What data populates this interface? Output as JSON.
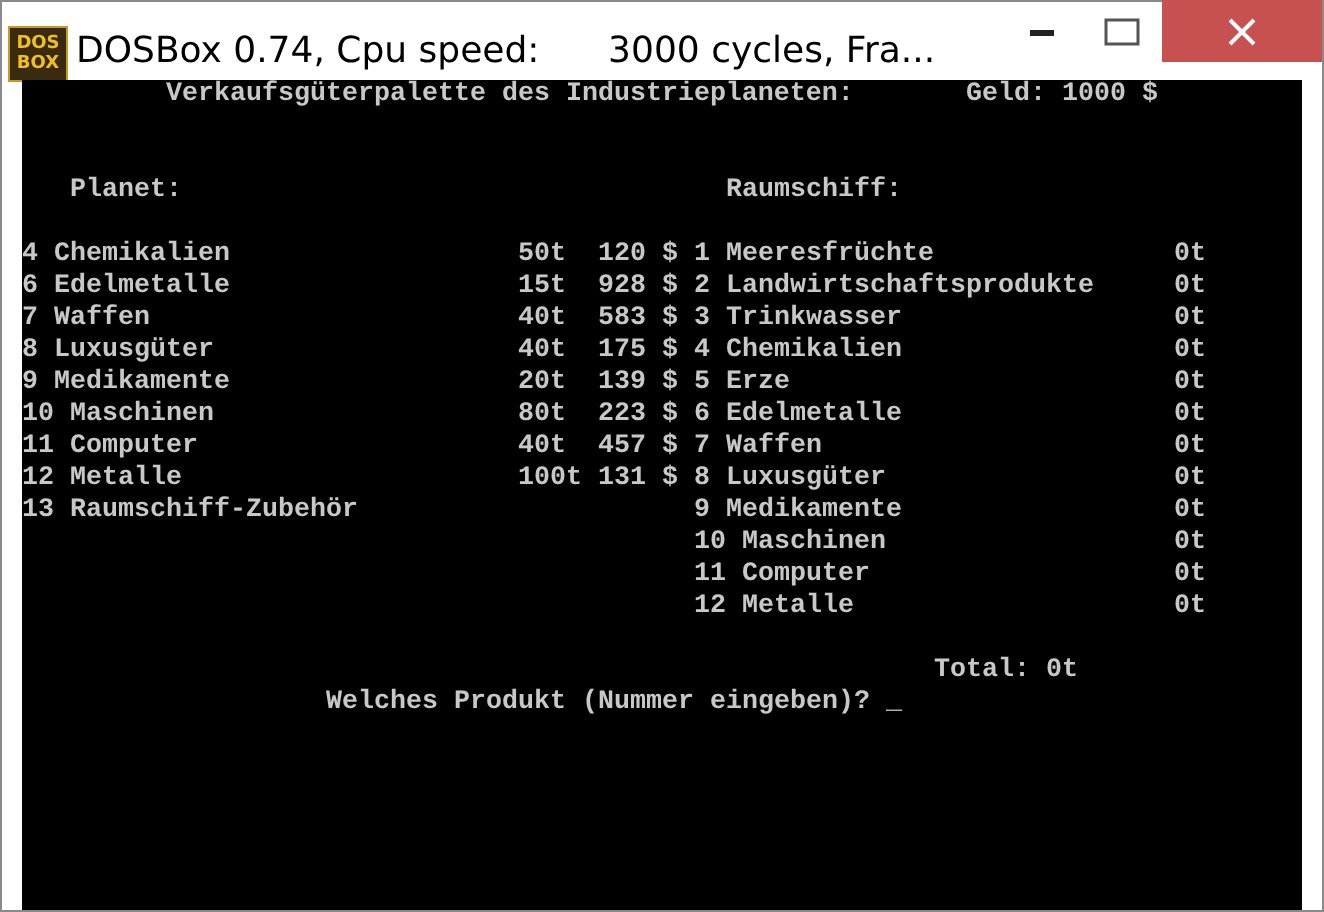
{
  "window": {
    "title": "DOSBox 0.74, Cpu speed:      3000 cycles, Fra...",
    "icon_lines": [
      "DOS",
      "BOX"
    ]
  },
  "screen": {
    "heading": "Verkaufsgüterpalette des Industrieplaneten:",
    "money": "Geld: 1000 $",
    "planet_heading": "Planet:",
    "ship_heading": "Raumschiff:",
    "planet_goods": [
      {
        "name": "4 Chemikalien",
        "weight": "50t",
        "price": "120 $"
      },
      {
        "name": "6 Edelmetalle",
        "weight": "15t",
        "price": "928 $"
      },
      {
        "name": "7 Waffen",
        "weight": "40t",
        "price": "583 $"
      },
      {
        "name": "8 Luxusgüter",
        "weight": "40t",
        "price": "175 $"
      },
      {
        "name": "9 Medikamente",
        "weight": "20t",
        "price": "139 $"
      },
      {
        "name": "10 Maschinen",
        "weight": "80t",
        "price": "223 $"
      },
      {
        "name": "11 Computer",
        "weight": "40t",
        "price": "457 $"
      },
      {
        "name": "12 Metalle",
        "weight": "100t",
        "price": "131 $"
      },
      {
        "name": "13 Raumschiff-Zubehör"
      }
    ],
    "ship_goods": [
      {
        "name": "1 Meeresfrüchte",
        "amount": "0t"
      },
      {
        "name": "2 Landwirtschaftsprodukte",
        "amount": "0t"
      },
      {
        "name": "3 Trinkwasser",
        "amount": "0t"
      },
      {
        "name": "4 Chemikalien",
        "amount": "0t"
      },
      {
        "name": "5 Erze",
        "amount": "0t"
      },
      {
        "name": "6 Edelmetalle",
        "amount": "0t"
      },
      {
        "name": "7 Waffen",
        "amount": "0t"
      },
      {
        "name": "8 Luxusgüter",
        "amount": "0t"
      },
      {
        "name": "9 Medikamente",
        "amount": "0t"
      },
      {
        "name": "10 Maschinen",
        "amount": "0t"
      },
      {
        "name": "11 Computer",
        "amount": "0t"
      },
      {
        "name": "12 Metalle",
        "amount": "0t"
      }
    ],
    "total": "Total: 0t",
    "prompt": "Welches Produkt (Nummer eingeben)?",
    "cursor": "_"
  }
}
